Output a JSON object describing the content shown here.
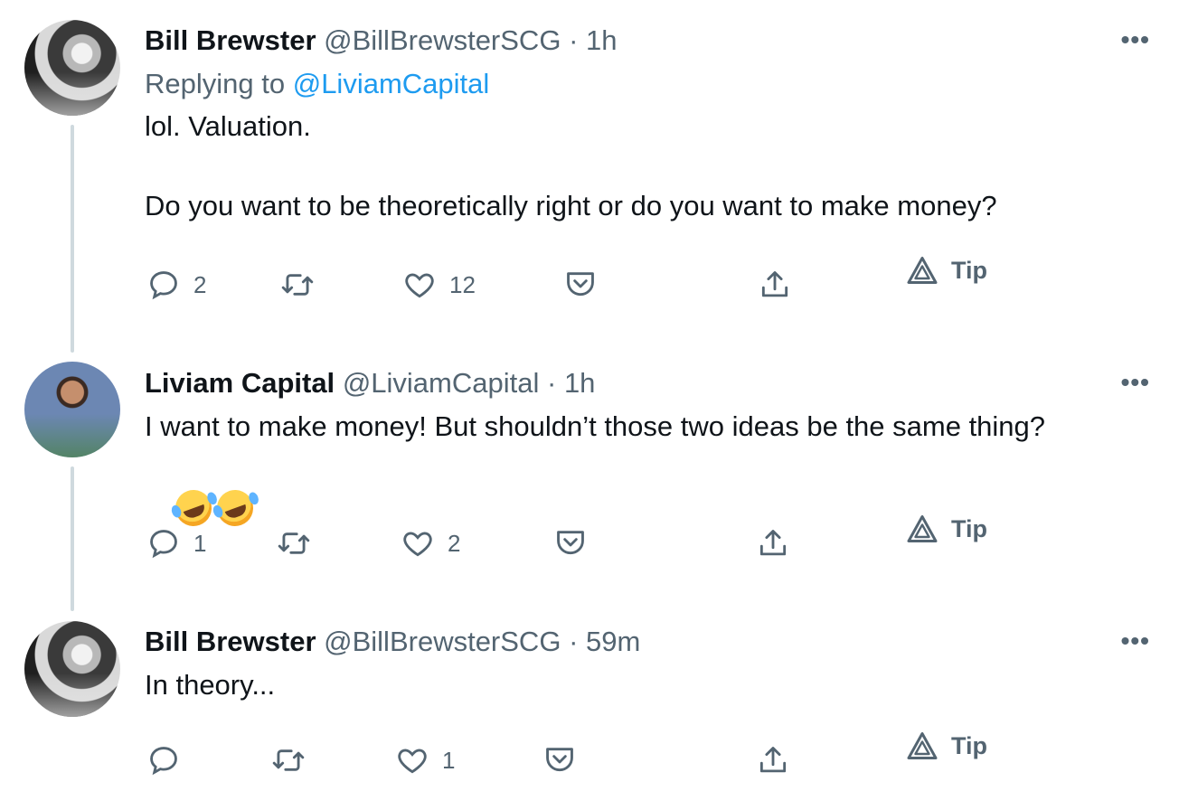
{
  "tweets": [
    {
      "name": "Bill Brewster",
      "handle": "@BillBrewsterSCG",
      "sep": "·",
      "time": "1h",
      "reply_prefix": "Replying to ",
      "reply_handle": "@LiviamCapital",
      "text": "lol. Valuation.\n\nDo you want to be theoretically right or do you want to make money?",
      "more": "•••",
      "replies": "2",
      "retweets": "",
      "likes": "12",
      "tip_label": "Tip"
    },
    {
      "name": "Liviam Capital",
      "handle": "@LiviamCapital",
      "sep": "·",
      "time": "1h",
      "text": "I want to make money! But shouldn’t those two ideas be the same thing?",
      "emoji": "🤣🤣",
      "more": "•••",
      "replies": "1",
      "retweets": "",
      "likes": "2",
      "tip_label": "Tip"
    },
    {
      "name": "Bill Brewster",
      "handle": "@BillBrewsterSCG",
      "sep": "·",
      "time": "59m",
      "text": "In theory...",
      "more": "•••",
      "replies": "",
      "retweets": "",
      "likes": "1",
      "tip_label": "Tip"
    }
  ],
  "icons": {
    "reply": "reply-icon",
    "retweet": "retweet-icon",
    "like": "heart-icon",
    "save": "pocket-icon",
    "share": "share-icon",
    "tip": "tip-icon"
  },
  "colors": {
    "text": "#0f1419",
    "muted": "#536471",
    "link": "#1d9bf0",
    "thread": "#cfd9de"
  }
}
